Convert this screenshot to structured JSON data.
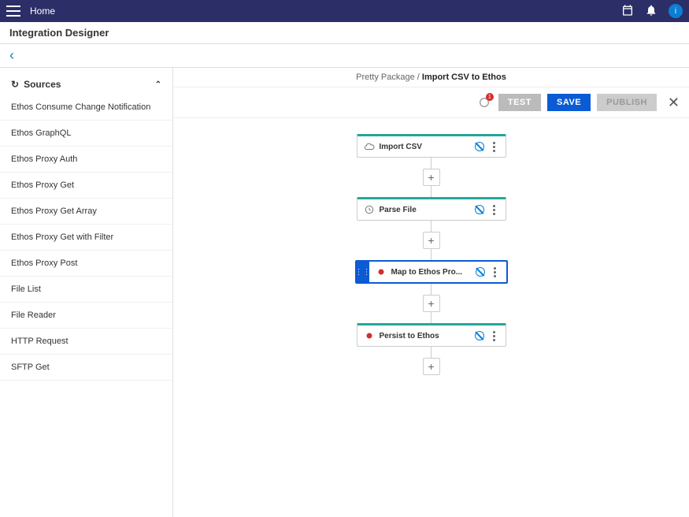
{
  "topbar": {
    "home": "Home",
    "avatar_letter": "i"
  },
  "subtitle": "Integration Designer",
  "sidebar": {
    "header": "Sources",
    "items": [
      "Ethos Consume Change Notification",
      "Ethos GraphQL",
      "Ethos Proxy Auth",
      "Ethos Proxy Get",
      "Ethos Proxy Get Array",
      "Ethos Proxy Get with Filter",
      "Ethos Proxy Post",
      "File List",
      "File Reader",
      "HTTP Request",
      "SFTP Get"
    ]
  },
  "breadcrumb": {
    "parent": "Pretty Package",
    "sep": "/",
    "current": "Import CSV to Ethos"
  },
  "toolbar": {
    "notif_count": "1",
    "test": "TEST",
    "save": "SAVE",
    "publish": "PUBLISH"
  },
  "nodes": [
    {
      "label": "Import CSV",
      "icon": "cloud"
    },
    {
      "label": "Parse File",
      "icon": "file"
    },
    {
      "label": "Map to Ethos Pro...",
      "icon": "map",
      "selected": true
    },
    {
      "label": "Persist to Ethos",
      "icon": "db"
    }
  ]
}
